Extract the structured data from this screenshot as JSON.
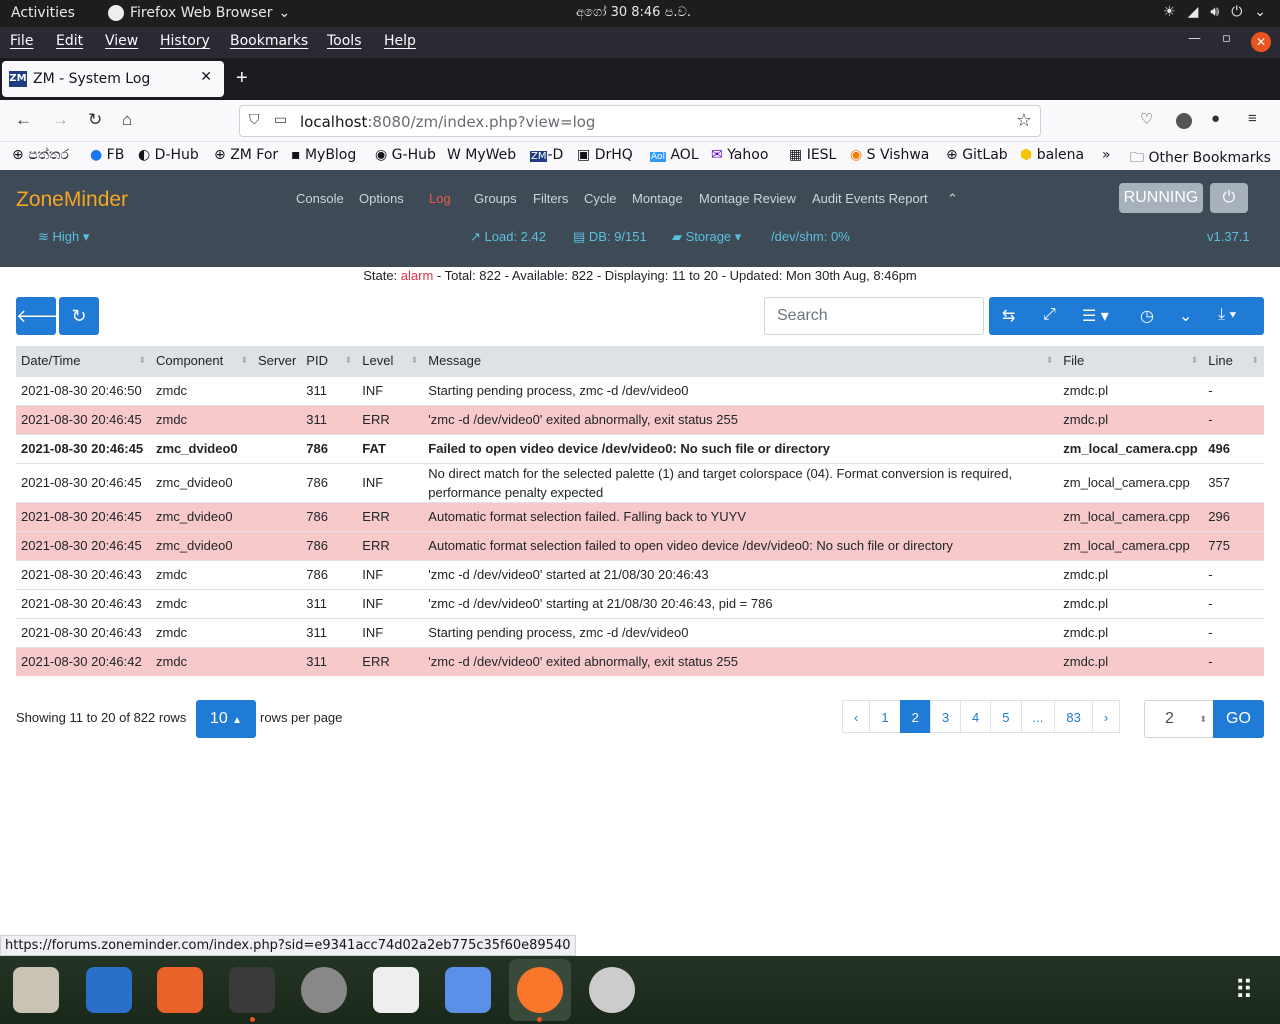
{
  "system": {
    "activities": "Activities",
    "app_name": "Firefox Web Browser",
    "clock": "අගෝ 30  8:46 ප.ව."
  },
  "menu": [
    "File",
    "Edit",
    "View",
    "History",
    "Bookmarks",
    "Tools",
    "Help"
  ],
  "tab": {
    "title": "ZM - System Log",
    "favicon": "ZM"
  },
  "url": {
    "host": "localhost",
    "rest": ":8080/zm/index.php?view=log"
  },
  "bookmarks": [
    "පත්තර",
    "FB",
    "D-Hub",
    "ZM For",
    "MyBlog",
    "G-Hub",
    "MyWeb",
    "-D",
    "DrHQ",
    "AOL",
    "Yahoo",
    "IESL",
    "S Vishwa",
    "GitLab",
    "balena",
    "Other Bookmarks"
  ],
  "zm": {
    "brand": "ZoneMinder",
    "nav": [
      "Console",
      "Options",
      "Log",
      "Groups",
      "Filters",
      "Cycle",
      "Montage",
      "Montage Review",
      "Audit Events Report"
    ],
    "active_nav": "Log",
    "running": "RUNNING",
    "status": {
      "bandwidth": "High",
      "load": "Load: 2.42",
      "db": "DB: 9/151",
      "storage": "Storage",
      "shm": "/dev/shm: 0%",
      "version": "v1.37.1"
    }
  },
  "state": {
    "prefix": "State: ",
    "alarm": "alarm",
    "rest": " -  Total: 822 -  Available: 822 -  Displaying: 11 to 20 -  Updated: Mon 30th Aug, 8:46pm"
  },
  "search_placeholder": "Search",
  "table": {
    "headers": [
      "Date/Time",
      "Component",
      "Server",
      "PID",
      "Level",
      "Message",
      "File",
      "Line"
    ],
    "rows": [
      {
        "level_class": "inf",
        "date": "2021-08-30 20:46:50",
        "component": "zmdc",
        "server": "",
        "pid": "311",
        "level": "INF",
        "message": "Starting pending process, zmc -d /dev/video0",
        "file": "zmdc.pl",
        "line": "-"
      },
      {
        "level_class": "err",
        "date": "2021-08-30 20:46:45",
        "component": "zmdc",
        "server": "",
        "pid": "311",
        "level": "ERR",
        "message": "'zmc -d /dev/video0' exited abnormally, exit status 255",
        "file": "zmdc.pl",
        "line": "-"
      },
      {
        "level_class": "fat",
        "date": "2021-08-30 20:46:45",
        "component": "zmc_dvideo0",
        "server": "",
        "pid": "786",
        "level": "FAT",
        "message": "Failed to open video device /dev/video0: No such file or directory",
        "file": "zm_local_camera.cpp",
        "line": "496"
      },
      {
        "level_class": "inf",
        "date": "2021-08-30 20:46:45",
        "component": "zmc_dvideo0",
        "server": "",
        "pid": "786",
        "level": "INF",
        "message": "No direct match for the selected palette (1) and target colorspace (04). Format conversion is required, performance penalty expected",
        "file": "zm_local_camera.cpp",
        "line": "357"
      },
      {
        "level_class": "err",
        "date": "2021-08-30 20:46:45",
        "component": "zmc_dvideo0",
        "server": "",
        "pid": "786",
        "level": "ERR",
        "message": "Automatic format selection failed. Falling back to YUYV",
        "file": "zm_local_camera.cpp",
        "line": "296"
      },
      {
        "level_class": "err",
        "date": "2021-08-30 20:46:45",
        "component": "zmc_dvideo0",
        "server": "",
        "pid": "786",
        "level": "ERR",
        "message": "Automatic format selection failed to open video device /dev/video0: No such file or directory",
        "file": "zm_local_camera.cpp",
        "line": "775"
      },
      {
        "level_class": "inf",
        "date": "2021-08-30 20:46:43",
        "component": "zmdc",
        "server": "",
        "pid": "786",
        "level": "INF",
        "message": "'zmc -d /dev/video0' started at 21/08/30 20:46:43",
        "file": "zmdc.pl",
        "line": "-"
      },
      {
        "level_class": "inf",
        "date": "2021-08-30 20:46:43",
        "component": "zmdc",
        "server": "",
        "pid": "311",
        "level": "INF",
        "message": "'zmc -d /dev/video0' starting at 21/08/30 20:46:43, pid = 786",
        "file": "zmdc.pl",
        "line": "-"
      },
      {
        "level_class": "inf",
        "date": "2021-08-30 20:46:43",
        "component": "zmdc",
        "server": "",
        "pid": "311",
        "level": "INF",
        "message": "Starting pending process, zmc -d /dev/video0",
        "file": "zmdc.pl",
        "line": "-"
      },
      {
        "level_class": "err",
        "date": "2021-08-30 20:46:42",
        "component": "zmdc",
        "server": "",
        "pid": "311",
        "level": "ERR",
        "message": "'zmc -d /dev/video0' exited abnormally, exit status 255",
        "file": "zmdc.pl",
        "line": "-"
      }
    ]
  },
  "pager": {
    "info": "Showing 11 to 20 of 822 rows",
    "rows_per_page": "10",
    "rpp_label": "rows per page",
    "pages": [
      "‹",
      "1",
      "2",
      "3",
      "4",
      "5",
      "...",
      "83",
      "›"
    ],
    "current": "2",
    "goto_value": "2",
    "go": "GO"
  },
  "status_url": "https://forums.zoneminder.com/index.php?sid=e9341acc74d02a2eb775c35f60e89540",
  "colors": {
    "accent": "#1f7bd6",
    "error_row": "#f8c9ca",
    "brand": "#f5a623",
    "navbar": "#3e4a56"
  }
}
